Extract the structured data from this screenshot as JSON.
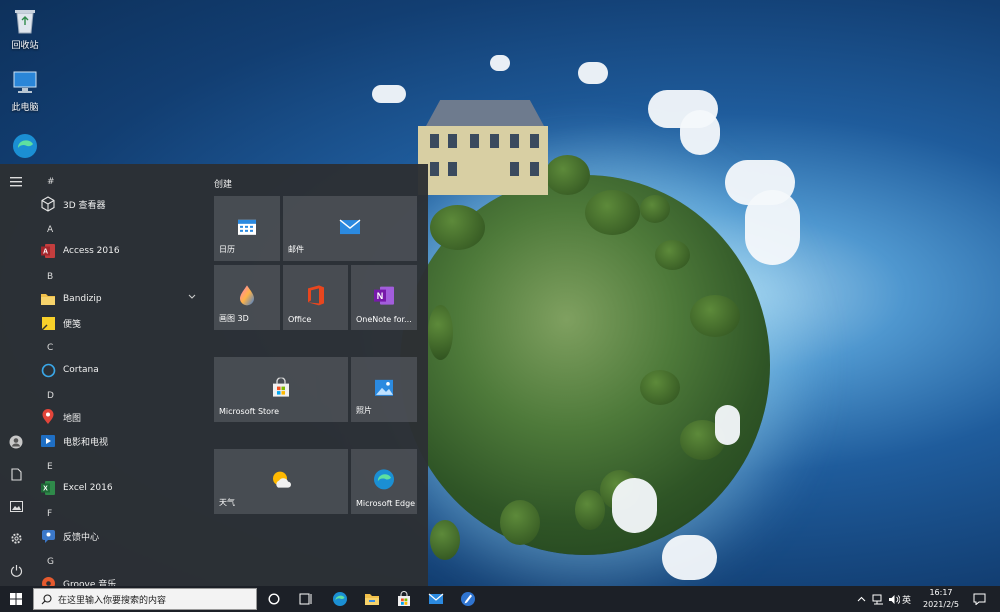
{
  "desktop": {
    "icons": [
      {
        "name": "recycle-bin",
        "label": "回收站"
      },
      {
        "name": "this-pc",
        "label": "此电脑"
      },
      {
        "name": "edge",
        "label": ""
      }
    ]
  },
  "start_menu": {
    "app_list": [
      {
        "type": "letter",
        "text": "#"
      },
      {
        "type": "app",
        "label": "3D 查看器",
        "icon": "3d-viewer-icon"
      },
      {
        "type": "letter",
        "text": "A"
      },
      {
        "type": "app",
        "label": "Access 2016",
        "icon": "access-icon"
      },
      {
        "type": "letter",
        "text": "B"
      },
      {
        "type": "app",
        "label": "Bandizip",
        "icon": "folder-icon",
        "expandable": true
      },
      {
        "type": "app",
        "label": "便笺",
        "icon": "sticky-notes-icon"
      },
      {
        "type": "letter",
        "text": "C"
      },
      {
        "type": "app",
        "label": "Cortana",
        "icon": "cortana-icon"
      },
      {
        "type": "letter",
        "text": "D"
      },
      {
        "type": "app",
        "label": "地图",
        "icon": "maps-icon"
      },
      {
        "type": "app",
        "label": "电影和电视",
        "icon": "movies-icon"
      },
      {
        "type": "letter",
        "text": "E"
      },
      {
        "type": "app",
        "label": "Excel 2016",
        "icon": "excel-icon"
      },
      {
        "type": "letter",
        "text": "F"
      },
      {
        "type": "app",
        "label": "反馈中心",
        "icon": "feedback-icon"
      },
      {
        "type": "letter",
        "text": "G"
      },
      {
        "type": "app",
        "label": "Groove 音乐",
        "icon": "groove-icon"
      }
    ],
    "group_title": "创建",
    "tiles": [
      {
        "label": "日历",
        "icon": "calendar-icon"
      },
      {
        "label": "邮件",
        "icon": "mail-icon"
      },
      {
        "label": "画图 3D",
        "icon": "paint3d-icon"
      },
      {
        "label": "Office",
        "icon": "office-icon"
      },
      {
        "label": "OneNote for...",
        "icon": "onenote-icon"
      },
      {
        "label": "Microsoft Store",
        "icon": "store-icon"
      },
      {
        "label": "照片",
        "icon": "photos-icon"
      },
      {
        "label": "天气",
        "icon": "weather-icon"
      },
      {
        "label": "Microsoft Edge",
        "icon": "edge-icon"
      }
    ]
  },
  "taskbar": {
    "search_placeholder": "在这里输入你要搜索的内容",
    "ime": "英",
    "time": "16:17",
    "date": "2021/2/5"
  },
  "colors": {
    "start_bg": "#2c2f34",
    "taskbar_bg": "#1c2027",
    "accent": "#0078d7"
  }
}
